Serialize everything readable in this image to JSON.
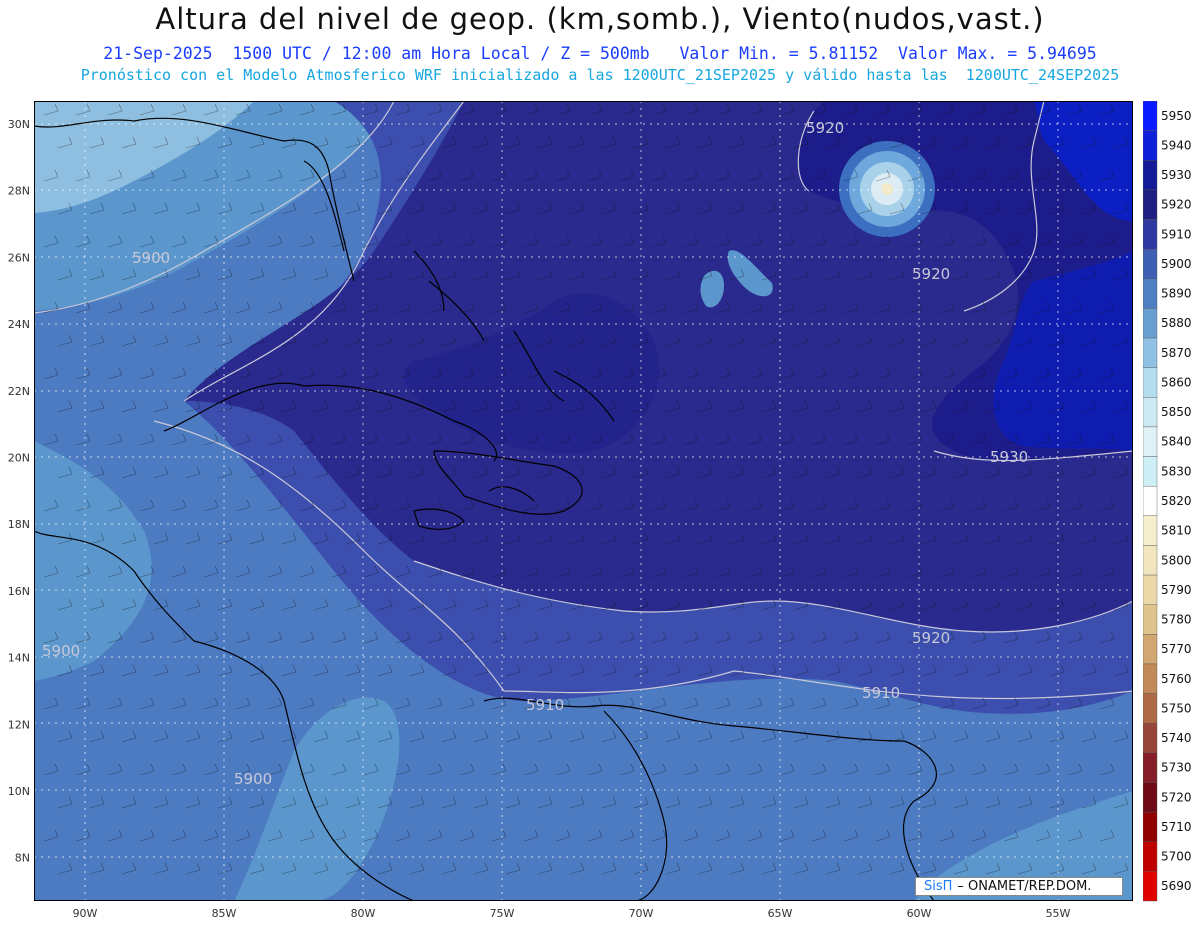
{
  "header": {
    "title": "Altura del nivel de geop. (km,somb.), Viento(nudos,vast.)",
    "line2": "21-Sep-2025  1500 UTC / 12:00 am Hora Local / Z = 500mb   Valor Min. = 5.81152  Valor Max. = 5.94695",
    "line3": "Pronóstico con el Modelo Atmosferico WRF inicializado a las 1200UTC_21SEP2025 y válido hasta las  1200UTC_24SEP2025"
  },
  "map": {
    "lat_ticks": [
      "30N",
      "28N",
      "26N",
      "24N",
      "22N",
      "20N",
      "18N",
      "16N",
      "14N",
      "12N",
      "10N",
      "8N"
    ],
    "lon_ticks": [
      "90W",
      "85W",
      "80W",
      "75W",
      "70W",
      "65W",
      "60W",
      "55W"
    ],
    "contour_labels": [
      "5920",
      "5900",
      "5920",
      "5930",
      "5920",
      "5910",
      "5910",
      "5900",
      "5900"
    ],
    "shading_colors": {
      "5880": "#8fbfe0",
      "5890": "#5b97cd",
      "5900": "#4e7ec4",
      "5910": "#3c4fae",
      "5920": "#2a2a8e",
      "5930": "#1c1c8a",
      "5940": "#0c1fc2"
    }
  },
  "colorbar": {
    "levels": [
      "5950",
      "5940",
      "5930",
      "5920",
      "5910",
      "5900",
      "5890",
      "5880",
      "5870",
      "5860",
      "5850",
      "5840",
      "5830",
      "5820",
      "5810",
      "5800",
      "5790",
      "5780",
      "5770",
      "5760",
      "5750",
      "5740",
      "5730",
      "5720",
      "5710",
      "5700",
      "5690"
    ],
    "colors": [
      "#0a1aff",
      "#1020d8",
      "#141a98",
      "#1e1f80",
      "#2f3aa0",
      "#3f5fb5",
      "#4f7ec2",
      "#6a9fd2",
      "#8fc2e2",
      "#b4dded",
      "#cde9f3",
      "#dff2f8",
      "#cfeff6",
      "#ffffff",
      "#f6efcd",
      "#f2e6bf",
      "#ecd9aa",
      "#e0c48e",
      "#d1a772",
      "#c28a58",
      "#ad6a44",
      "#98453a",
      "#861e2a",
      "#6e0a16",
      "#900000",
      "#c00000",
      "#e00000"
    ]
  },
  "logo": {
    "sis": "SisΠ",
    "text": "– ONAMET/REP.DOM."
  }
}
